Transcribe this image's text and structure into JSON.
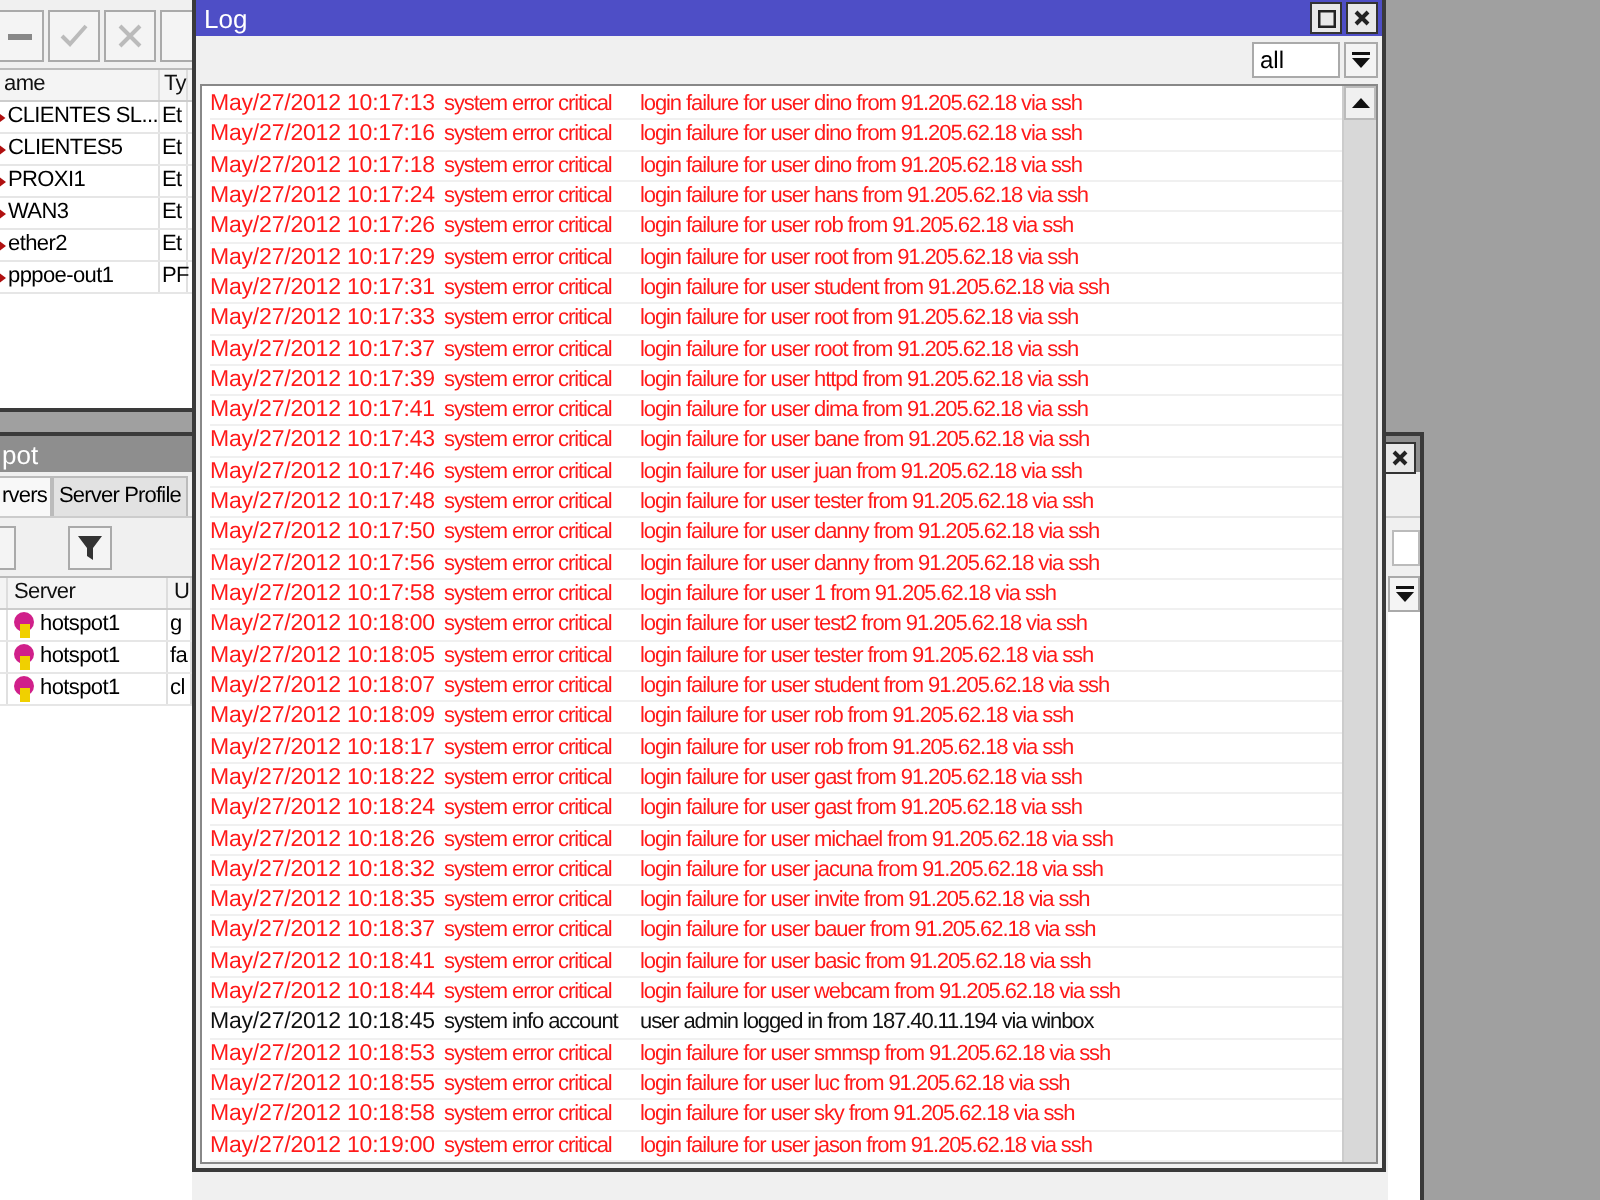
{
  "interfaces_window": {
    "columns": [
      "ame",
      "Ty"
    ],
    "rows": [
      {
        "name": "CLIENTES SL...",
        "type": "Et"
      },
      {
        "name": "CLIENTES5",
        "type": "Et"
      },
      {
        "name": "PROXI1",
        "type": "Et"
      },
      {
        "name": "WAN3",
        "type": "Et"
      },
      {
        "name": "ether2",
        "type": "Et"
      },
      {
        "name": "pppoe-out1",
        "type": "PF"
      }
    ]
  },
  "hotspot_window": {
    "title": "pot",
    "tabs": [
      {
        "label": "rvers",
        "selected": true
      },
      {
        "label": "Server Profile",
        "selected": false
      }
    ],
    "columns": [
      "Server",
      "U"
    ],
    "rows": [
      {
        "server": "hotspot1",
        "user": "g"
      },
      {
        "server": "hotspot1",
        "user": "fa"
      },
      {
        "server": "hotspot1",
        "user": "cl"
      }
    ]
  },
  "log_window": {
    "title": "Log",
    "filter": "all",
    "rows": [
      {
        "time": "May/27/2012 10:17:13",
        "topics": "system error critical",
        "message": "login failure for user dino from 91.205.62.18 via ssh",
        "kind": "error"
      },
      {
        "time": "May/27/2012 10:17:16",
        "topics": "system error critical",
        "message": "login failure for user dino from 91.205.62.18 via ssh",
        "kind": "error"
      },
      {
        "time": "May/27/2012 10:17:18",
        "topics": "system error critical",
        "message": "login failure for user dino from 91.205.62.18 via ssh",
        "kind": "error"
      },
      {
        "time": "May/27/2012 10:17:24",
        "topics": "system error critical",
        "message": "login failure for user hans from 91.205.62.18 via ssh",
        "kind": "error"
      },
      {
        "time": "May/27/2012 10:17:26",
        "topics": "system error critical",
        "message": "login failure for user rob from 91.205.62.18 via ssh",
        "kind": "error"
      },
      {
        "time": "May/27/2012 10:17:29",
        "topics": "system error critical",
        "message": "login failure for user root from 91.205.62.18 via ssh",
        "kind": "error"
      },
      {
        "time": "May/27/2012 10:17:31",
        "topics": "system error critical",
        "message": "login failure for user student from 91.205.62.18 via ssh",
        "kind": "error"
      },
      {
        "time": "May/27/2012 10:17:33",
        "topics": "system error critical",
        "message": "login failure for user root from 91.205.62.18 via ssh",
        "kind": "error"
      },
      {
        "time": "May/27/2012 10:17:37",
        "topics": "system error critical",
        "message": "login failure for user root from 91.205.62.18 via ssh",
        "kind": "error"
      },
      {
        "time": "May/27/2012 10:17:39",
        "topics": "system error critical",
        "message": "login failure for user httpd from 91.205.62.18 via ssh",
        "kind": "error"
      },
      {
        "time": "May/27/2012 10:17:41",
        "topics": "system error critical",
        "message": "login failure for user dima from 91.205.62.18 via ssh",
        "kind": "error"
      },
      {
        "time": "May/27/2012 10:17:43",
        "topics": "system error critical",
        "message": "login failure for user bane from 91.205.62.18 via ssh",
        "kind": "error"
      },
      {
        "time": "May/27/2012 10:17:46",
        "topics": "system error critical",
        "message": "login failure for user juan from 91.205.62.18 via ssh",
        "kind": "error"
      },
      {
        "time": "May/27/2012 10:17:48",
        "topics": "system error critical",
        "message": "login failure for user tester from 91.205.62.18 via ssh",
        "kind": "error"
      },
      {
        "time": "May/27/2012 10:17:50",
        "topics": "system error critical",
        "message": "login failure for user danny from 91.205.62.18 via ssh",
        "kind": "error"
      },
      {
        "time": "May/27/2012 10:17:56",
        "topics": "system error critical",
        "message": "login failure for user danny from 91.205.62.18 via ssh",
        "kind": "error"
      },
      {
        "time": "May/27/2012 10:17:58",
        "topics": "system error critical",
        "message": "login failure for user 1 from 91.205.62.18 via ssh",
        "kind": "error"
      },
      {
        "time": "May/27/2012 10:18:00",
        "topics": "system error critical",
        "message": "login failure for user test2 from 91.205.62.18 via ssh",
        "kind": "error"
      },
      {
        "time": "May/27/2012 10:18:05",
        "topics": "system error critical",
        "message": "login failure for user tester from 91.205.62.18 via ssh",
        "kind": "error"
      },
      {
        "time": "May/27/2012 10:18:07",
        "topics": "system error critical",
        "message": "login failure for user student from 91.205.62.18 via ssh",
        "kind": "error"
      },
      {
        "time": "May/27/2012 10:18:09",
        "topics": "system error critical",
        "message": "login failure for user rob from 91.205.62.18 via ssh",
        "kind": "error"
      },
      {
        "time": "May/27/2012 10:18:17",
        "topics": "system error critical",
        "message": "login failure for user rob from 91.205.62.18 via ssh",
        "kind": "error"
      },
      {
        "time": "May/27/2012 10:18:22",
        "topics": "system error critical",
        "message": "login failure for user gast from 91.205.62.18 via ssh",
        "kind": "error"
      },
      {
        "time": "May/27/2012 10:18:24",
        "topics": "system error critical",
        "message": "login failure for user gast from 91.205.62.18 via ssh",
        "kind": "error"
      },
      {
        "time": "May/27/2012 10:18:26",
        "topics": "system error critical",
        "message": "login failure for user michael from 91.205.62.18 via ssh",
        "kind": "error"
      },
      {
        "time": "May/27/2012 10:18:32",
        "topics": "system error critical",
        "message": "login failure for user jacuna from 91.205.62.18 via ssh",
        "kind": "error"
      },
      {
        "time": "May/27/2012 10:18:35",
        "topics": "system error critical",
        "message": "login failure for user invite from 91.205.62.18 via ssh",
        "kind": "error"
      },
      {
        "time": "May/27/2012 10:18:37",
        "topics": "system error critical",
        "message": "login failure for user bauer from 91.205.62.18 via ssh",
        "kind": "error"
      },
      {
        "time": "May/27/2012 10:18:41",
        "topics": "system error critical",
        "message": "login failure for user basic from 91.205.62.18 via ssh",
        "kind": "error"
      },
      {
        "time": "May/27/2012 10:18:44",
        "topics": "system error critical",
        "message": "login failure for user webcam from 91.205.62.18 via ssh",
        "kind": "error"
      },
      {
        "time": "May/27/2012 10:18:45",
        "topics": "system info account",
        "message": "user admin logged in from 187.40.11.194 via winbox",
        "kind": "info"
      },
      {
        "time": "May/27/2012 10:18:53",
        "topics": "system error critical",
        "message": "login failure for user smmsp from 91.205.62.18 via ssh",
        "kind": "error"
      },
      {
        "time": "May/27/2012 10:18:55",
        "topics": "system error critical",
        "message": "login failure for user luc from 91.205.62.18 via ssh",
        "kind": "error"
      },
      {
        "time": "May/27/2012 10:18:58",
        "topics": "system error critical",
        "message": "login failure for user sky from 91.205.62.18 via ssh",
        "kind": "error"
      },
      {
        "time": "May/27/2012 10:19:00",
        "topics": "system error critical",
        "message": "login failure for user jason from 91.205.62.18 via ssh",
        "kind": "error"
      }
    ]
  }
}
